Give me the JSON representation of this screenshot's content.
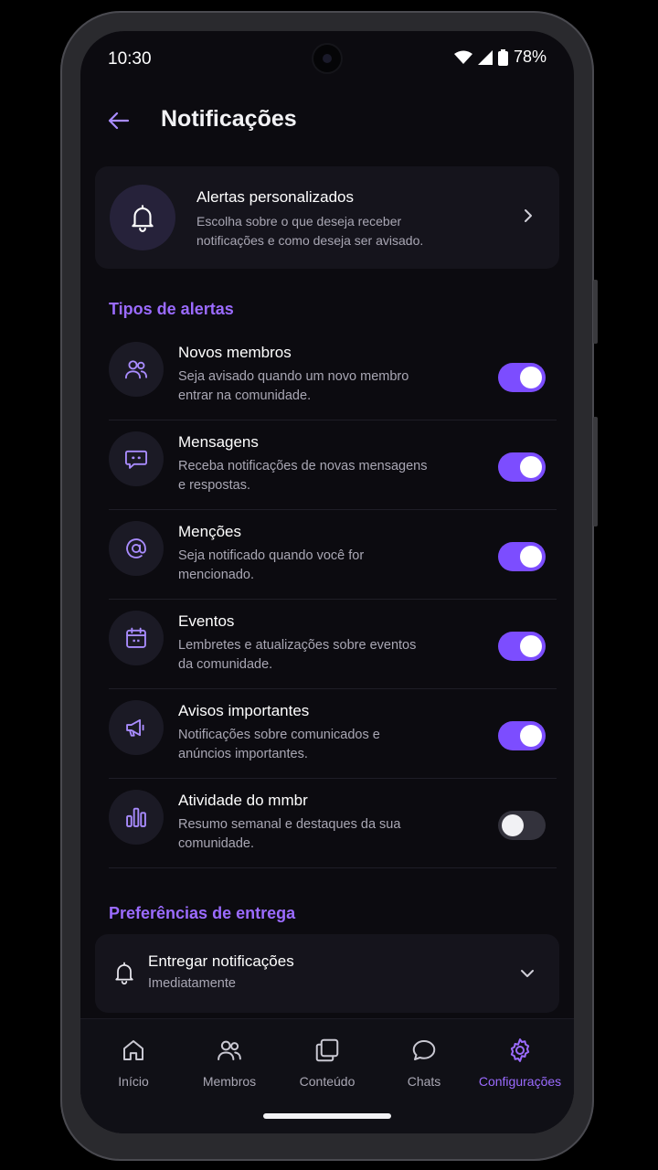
{
  "status": {
    "time": "10:30",
    "battery": "78%"
  },
  "header": {
    "title": "Notificações"
  },
  "promo": {
    "title": "Alertas personalizados",
    "subtitle": "Escolha sobre o que deseja receber notificações e como deseja ser avisado."
  },
  "alert_section": {
    "title": "Tipos de alertas"
  },
  "alerts": [
    {
      "title": "Novos membros",
      "subtitle": "Seja avisado quando um novo membro entrar na comunidade.",
      "icon": "members-icon",
      "enabled": true
    },
    {
      "title": "Mensagens",
      "subtitle": "Receba notificações de novas mensagens e respostas.",
      "icon": "message-icon",
      "enabled": true
    },
    {
      "title": "Menções",
      "subtitle": "Seja notificado quando você for mencionado.",
      "icon": "at-icon",
      "enabled": true
    },
    {
      "title": "Eventos",
      "subtitle": "Lembretes e atualizações sobre eventos da comunidade.",
      "icon": "calendar-icon",
      "enabled": true
    },
    {
      "title": "Avisos importantes",
      "subtitle": "Notificações sobre comunicados e anúncios importantes.",
      "icon": "megaphone-icon",
      "enabled": true
    },
    {
      "title": "Atividade do mmbr",
      "subtitle": "Resumo semanal e destaques da sua comunidade.",
      "icon": "bar-chart-icon",
      "enabled": false
    }
  ],
  "delivery_section": {
    "title": "Preferências de entrega"
  },
  "delivery": {
    "title": "Entregar notificações",
    "value": "Imediatamente"
  },
  "nav": {
    "items": [
      {
        "label": "Início",
        "icon": "home-icon"
      },
      {
        "label": "Membros",
        "icon": "members-icon"
      },
      {
        "label": "Conteúdo",
        "icon": "content-icon"
      },
      {
        "label": "Chats",
        "icon": "chat-icon"
      },
      {
        "label": "Configurações",
        "icon": "settings-icon",
        "active": true
      }
    ]
  },
  "colors": {
    "accent": "#9b6bff",
    "toggle_on": "#7c4dff",
    "background": "#0c0b10",
    "card": "#15141c"
  }
}
